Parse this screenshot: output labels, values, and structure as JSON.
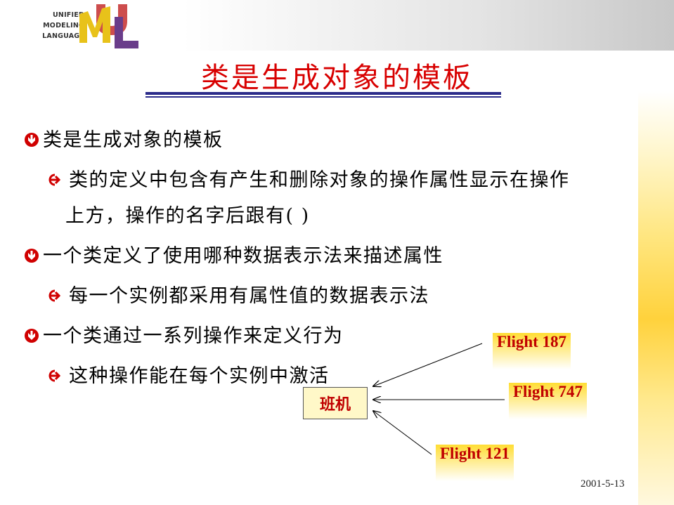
{
  "logo": {
    "line1": "UNIFIED",
    "line2": "MODELING",
    "line3": "LANGUAGE",
    "colors": {
      "u": "#e8c21a",
      "m": "#c83a3a",
      "l": "#6a3d8a"
    }
  },
  "title": "类是生成对象的模板",
  "bullets": [
    {
      "text": "类是生成对象的模板"
    },
    {
      "text": "类的定义中包含有产生和删除对象的操作属性显示在操作"
    },
    {
      "text": "上方，操作的名字后跟有( )"
    },
    {
      "text": "一个类定义了使用哪种数据表示法来描述属性"
    },
    {
      "text": "每一个实例都采用有属性值的数据表示法"
    },
    {
      "text": "一个类通过一系列操作来定义行为"
    },
    {
      "text": "这种操作能在每个实例中激活"
    }
  ],
  "diagram": {
    "class_label": "班机",
    "instances": [
      "Flight 187",
      "Flight 747",
      "Flight 121"
    ]
  },
  "date": "2001-5-13",
  "colors": {
    "title": "#d80000",
    "rule": "#2b2b8a",
    "bullet_icon": "#d00000",
    "highlight": "#ffdd33"
  }
}
